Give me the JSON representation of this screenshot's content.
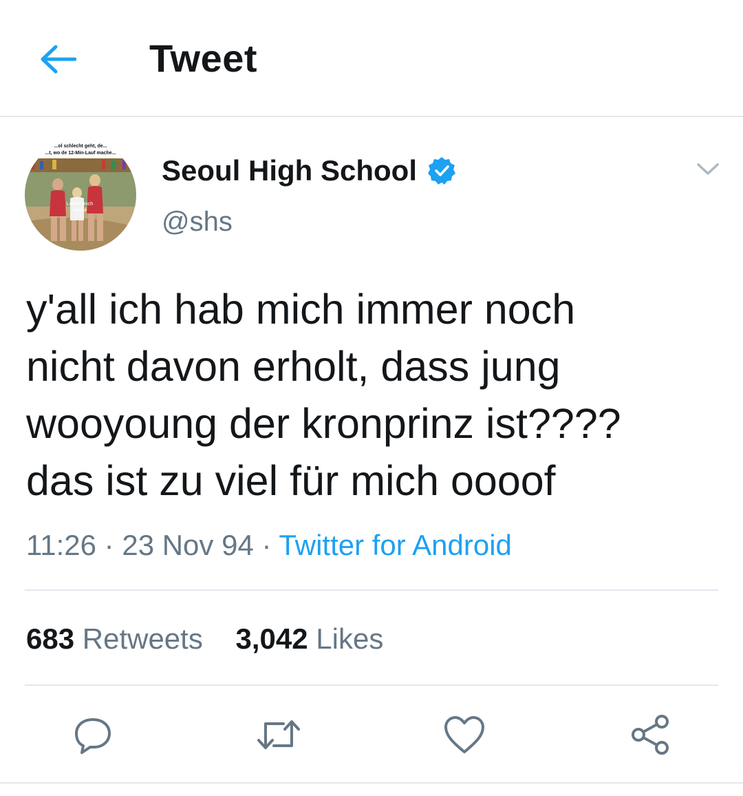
{
  "header": {
    "title": "Tweet",
    "back_icon": "arrow-left-icon"
  },
  "colors": {
    "accent": "#1da1f2",
    "text_primary": "#14171a",
    "text_secondary": "#657786",
    "divider": "#e1e8ed"
  },
  "author": {
    "display_name": "Seoul High School",
    "handle": "@shs",
    "verified": true,
    "avatar_caption_top": "...ol schlecht geht, de...",
    "avatar_caption_top_2": "...t, wo de 12-Min-Lauf mache...",
    "avatar_caption_bottom": "Lohne mich\nsterbe"
  },
  "tweet": {
    "text": "y'all ich hab mich immer noch\nnicht davon erholt, dass jung\nwooyoung der kronprinz ist????\ndas ist zu viel für mich oooof",
    "time": "11:26",
    "date": "23 Nov 94",
    "separator": "·",
    "source": "Twitter for Android"
  },
  "stats": {
    "retweets_count": "683",
    "retweets_label": "Retweets",
    "likes_count": "3,042",
    "likes_label": "Likes"
  },
  "actions": [
    "reply-icon",
    "retweet-icon",
    "like-icon",
    "share-icon"
  ]
}
